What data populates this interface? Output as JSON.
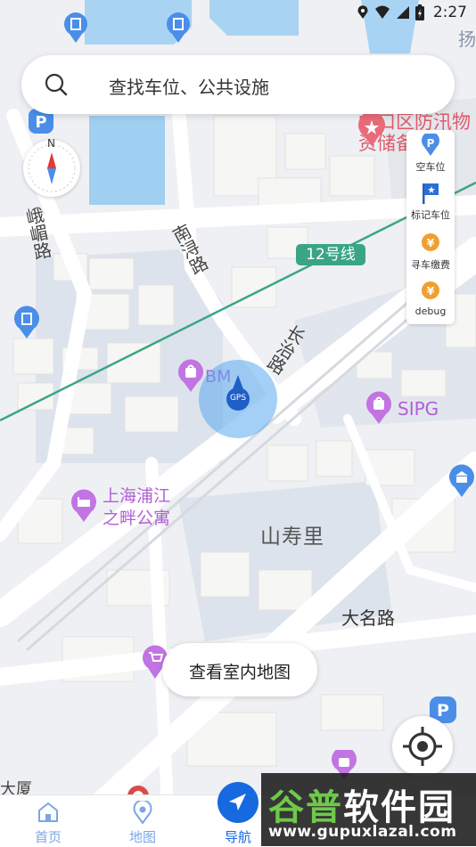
{
  "status_bar": {
    "time": "2:27"
  },
  "search": {
    "placeholder": "查找车位、公共设施"
  },
  "compass": {
    "north_label": "N"
  },
  "side_panel": {
    "items": [
      {
        "label": "空车位",
        "icon": "parking-pin-icon"
      },
      {
        "label": "标记车位",
        "icon": "flag-icon"
      },
      {
        "label": "寻车缴费",
        "icon": "yen-coin-icon"
      },
      {
        "label": "debug",
        "icon": "yen-coin-icon"
      }
    ]
  },
  "map": {
    "labels": {
      "top_right_char": "扬",
      "hongkou_poi": "虹口区防汛物资储备中心",
      "line12": "12号线",
      "road_ezhu": "峨嵋路",
      "road_nanxun": "南浔路",
      "road_changzhi": "长治路",
      "poi_bm": "BM",
      "gps_marker": "GPS",
      "poi_sipg": "SIPG",
      "poi_apartment_line1": "上海浦江",
      "poi_apartment_line2": "之畔公寓",
      "area_shanshouli": "山寿里",
      "road_daming": "大名路",
      "building_bottom_left": "大厦"
    },
    "colors": {
      "background": "#eef0f3",
      "water": "#a9d3f3",
      "metro_line": "#3aa585",
      "location_circle": "#5aa9f0",
      "poi_purple": "#b25fd6"
    }
  },
  "indoor_button": {
    "label": "查看室内地图"
  },
  "bottom_nav": {
    "items": [
      {
        "label": "首页",
        "icon": "home-icon",
        "active": false
      },
      {
        "label": "地图",
        "icon": "map-pin-icon",
        "active": false
      },
      {
        "label": "导航",
        "icon": "navigation-arrow-icon",
        "active": true
      }
    ]
  },
  "watermark": {
    "text_green": "谷普",
    "text_white": "软件园",
    "url": "www.gupuxlazal.com"
  }
}
